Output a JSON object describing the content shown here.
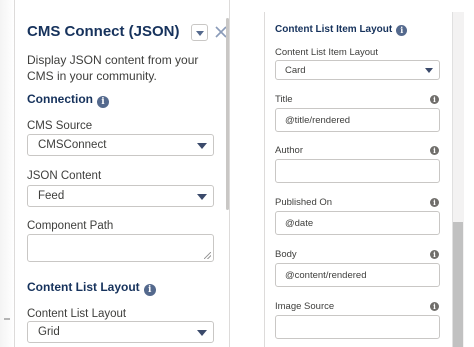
{
  "left_panel": {
    "title": "CMS Connect (JSON)",
    "description": "Display JSON content from your CMS in your community.",
    "connection_heading": "Connection",
    "cms_source": {
      "label": "CMS Source",
      "value": "CMSConnect"
    },
    "json_content": {
      "label": "JSON Content",
      "value": "Feed"
    },
    "component_path": {
      "label": "Component Path",
      "value": ""
    },
    "content_list_heading": "Content List Layout",
    "content_list_layout": {
      "label": "Content List Layout",
      "value": "Grid"
    }
  },
  "right_panel": {
    "heading": "Content List Item Layout",
    "item_layout": {
      "label": "Content List Item Layout",
      "value": "Card"
    },
    "fields": [
      {
        "label": "Title",
        "value": "@title/rendered"
      },
      {
        "label": "Author",
        "value": ""
      },
      {
        "label": "Published On",
        "value": "@date"
      },
      {
        "label": "Body",
        "value": "@content/rendered"
      },
      {
        "label": "Image Source",
        "value": ""
      }
    ]
  },
  "icons": {
    "info": "i",
    "close": "close-icon",
    "dropdown": "chevron-down-icon"
  },
  "colors": {
    "heading": "#16325c",
    "info_icon": "#54698d",
    "border": "#c9c7c5"
  }
}
